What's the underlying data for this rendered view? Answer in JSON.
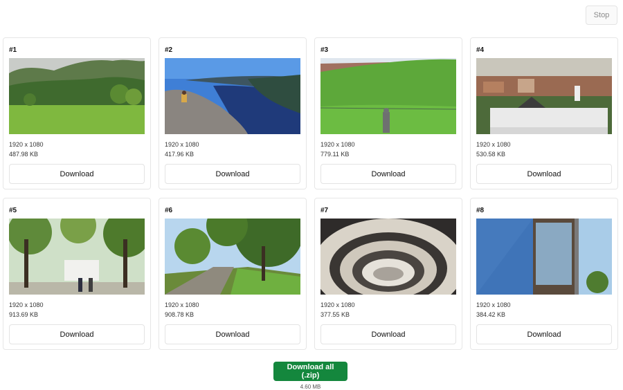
{
  "toolbar": {
    "stop_label": "Stop"
  },
  "images": [
    {
      "index": "#1",
      "dimensions": "1920 x 1080",
      "size": "487.98 KB",
      "download_label": "Download",
      "scene": "green-field-mountains"
    },
    {
      "index": "#2",
      "dimensions": "1920 x 1080",
      "size": "417.96 KB",
      "download_label": "Download",
      "scene": "fjord-cliff"
    },
    {
      "index": "#3",
      "dimensions": "1920 x 1080",
      "size": "779.11 KB",
      "download_label": "Download",
      "scene": "grass-hill-statue"
    },
    {
      "index": "#4",
      "dimensions": "1920 x 1080",
      "size": "530.58 KB",
      "download_label": "Download",
      "scene": "old-town-rooftops"
    },
    {
      "index": "#5",
      "dimensions": "1920 x 1080",
      "size": "913.69 KB",
      "download_label": "Download",
      "scene": "tree-avenue-people"
    },
    {
      "index": "#6",
      "dimensions": "1920 x 1080",
      "size": "908.78 KB",
      "download_label": "Download",
      "scene": "park-path-trees"
    },
    {
      "index": "#7",
      "dimensions": "1920 x 1080",
      "size": "377.55 KB",
      "download_label": "Download",
      "scene": "spiral-staircase"
    },
    {
      "index": "#8",
      "dimensions": "1920 x 1080",
      "size": "384.42 KB",
      "download_label": "Download",
      "scene": "blue-facade-building"
    }
  ],
  "footer": {
    "download_all_label": "Download all (.zip)",
    "total_size": "4.60 MB"
  },
  "colors": {
    "accent": "#14873d"
  }
}
